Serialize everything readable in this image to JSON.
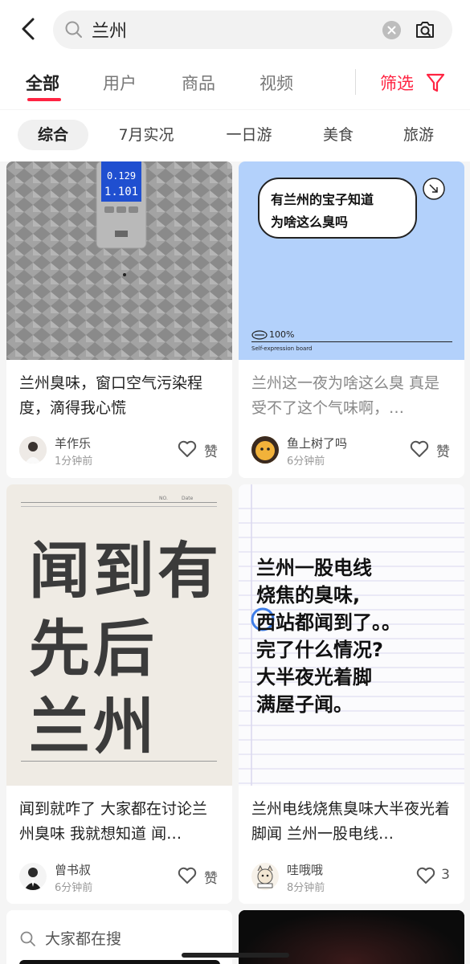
{
  "search": {
    "query": "兰州",
    "placeholder": "兰州"
  },
  "tabs": [
    {
      "label": "全部"
    },
    {
      "label": "用户"
    },
    {
      "label": "商品"
    },
    {
      "label": "视频"
    }
  ],
  "filter_label": "筛选",
  "chips": [
    {
      "label": "综合"
    },
    {
      "label": "7月实况"
    },
    {
      "label": "一日游"
    },
    {
      "label": "美食"
    },
    {
      "label": "旅游"
    }
  ],
  "cards": [
    {
      "title": "兰州臭味，窗口空气污染程度，滴得我心慌",
      "author": "羊作乐",
      "time": "1分钟前",
      "like_label": "赞",
      "image": {
        "meter_line1": "0.129",
        "meter_line2": "1.101"
      }
    },
    {
      "title": "兰州这一夜为啥这么臭 真是受不了这个气味啊，…",
      "author": "鱼上树了吗",
      "time": "6分钟前",
      "like_label": "赞",
      "image": {
        "bubble_line1": "有兰州的宝子知道",
        "bubble_line2": "为啥这么臭吗",
        "footer_pct": "100%",
        "footer_caption": "Self-expression board"
      }
    },
    {
      "title": "闻到就咋了 大家都在讨论兰州臭味 我就想知道 闻…",
      "author": "曾书叔",
      "time": "6分钟前",
      "like_label": "赞",
      "image": {
        "line1": "闻到有",
        "line2": "先后",
        "line3": "兰州",
        "no_label": "NO.",
        "date_label": "Date"
      }
    },
    {
      "title": "兰州电线烧焦臭味大半夜光着脚闻 兰州一股电线…",
      "author": "哇哦哦",
      "time": "8分钟前",
      "like_label": "3",
      "image": {
        "lines": [
          "兰州一股电线",
          "烧焦的臭味,",
          "西站都闻到了。。",
          "完了什么情况?",
          "大半夜光着脚",
          "满屋子闻。"
        ]
      }
    }
  ],
  "trending_label": "大家都在搜",
  "colors": {
    "accent": "#ff2442",
    "blue_card": "#b3d1fb",
    "paper": "#efebe4"
  }
}
